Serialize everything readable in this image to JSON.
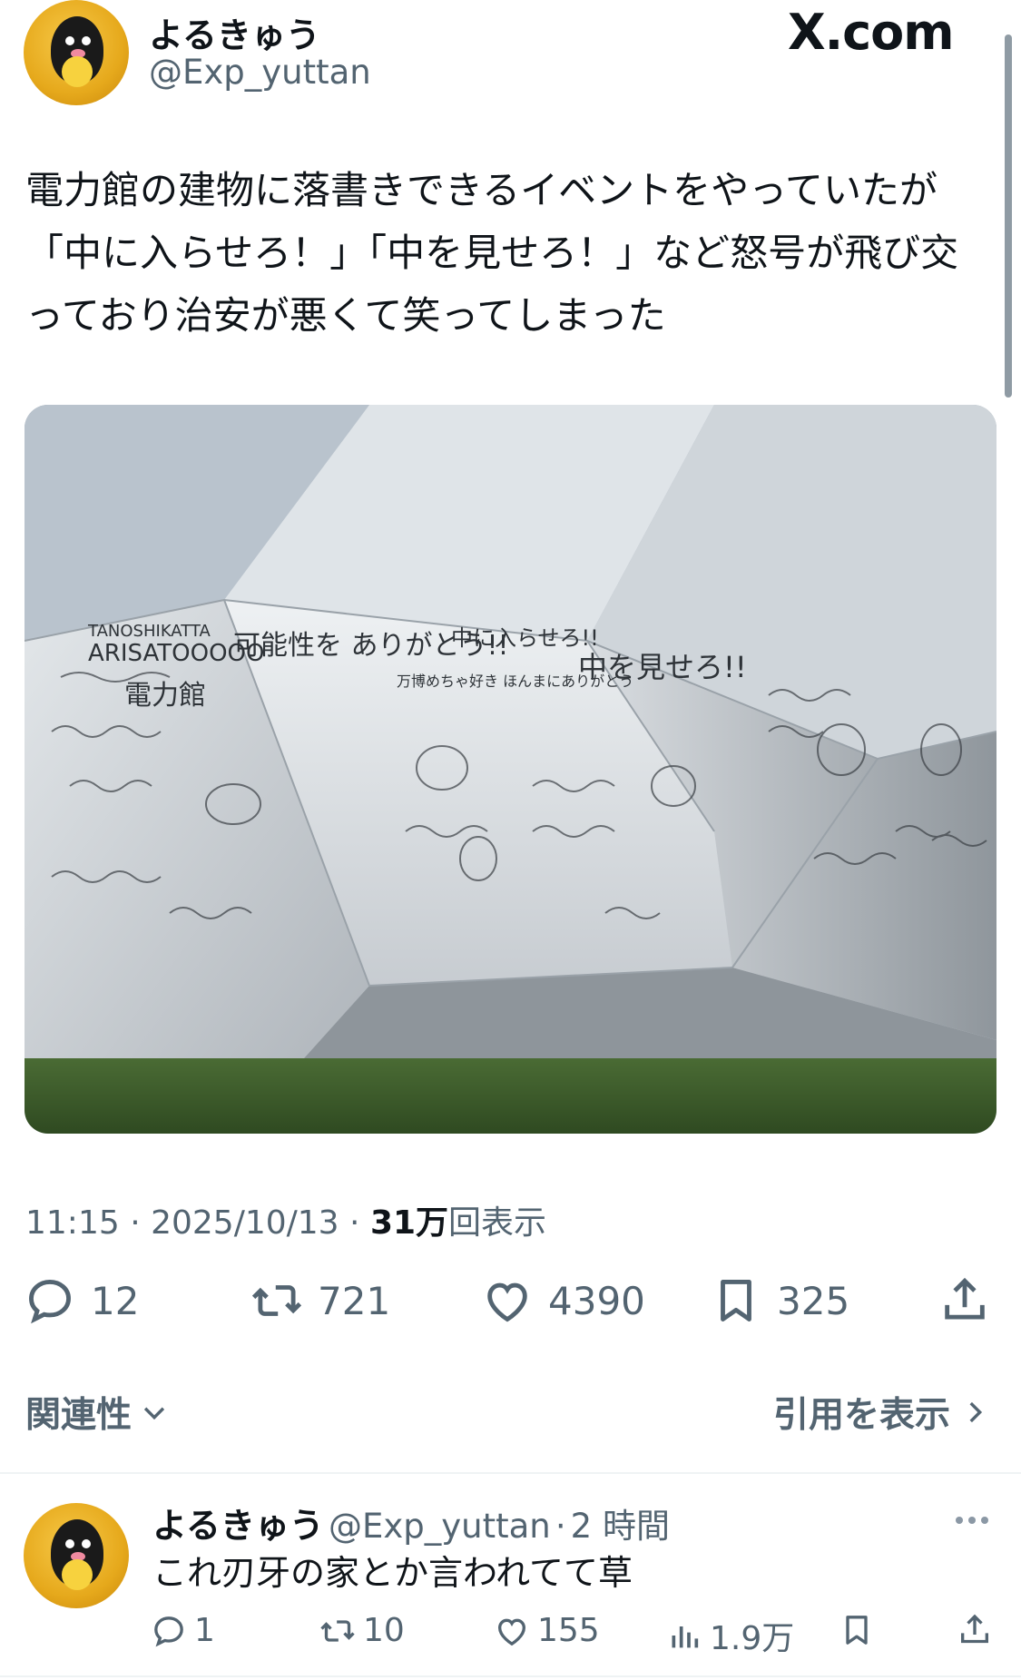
{
  "post": {
    "author_name": "よるきゅう",
    "author_handle": "@Exp_yuttan",
    "brand": "X.com",
    "text_lines": [
      "電力館の建物に落書きできるイベントをやっていたが",
      "「中に入らせろ！」「中を見せろ！」など怒号が飛び交",
      "っており治安が悪くて笑ってしまった"
    ],
    "meta": {
      "time": "11:15",
      "date": "2025/10/13",
      "views_count": "31万",
      "views_label": "回表示"
    },
    "actions": {
      "replies": "12",
      "reposts": "721",
      "likes": "4390",
      "bookmarks": "325"
    }
  },
  "photo_wall_text": {
    "left_panel": "TANOSHIKATTA",
    "arisato": "ARISATOOOOO",
    "denryokukan": "電力館",
    "kanousei": "可能性を ありがとう!!",
    "naka_ni": "中に入らせろ!!",
    "naka_wo": "中を見せろ!!",
    "banpaku": "万博めちゃ好き ほんまにありがとう"
  },
  "sort": {
    "relevance_label": "関連性",
    "quotes_label": "引用を表示"
  },
  "reply": {
    "author_name": "よるきゅう",
    "author_handle": "@Exp_yuttan",
    "time_ago": "2 時間",
    "text": "これ刃牙の家とか言われてて草",
    "actions": {
      "replies": "1",
      "reposts": "10",
      "likes": "155",
      "views": "1.9万"
    }
  },
  "colors": {
    "text_primary": "#0f1419",
    "text_secondary": "#536471",
    "divider": "#eff3f4",
    "avatar_bg": "#f0b429"
  },
  "icons": [
    "reply-icon",
    "repost-icon",
    "like-icon",
    "bookmark-icon",
    "share-icon",
    "chevron-down-icon",
    "chevron-right-icon",
    "more-icon",
    "views-icon"
  ]
}
